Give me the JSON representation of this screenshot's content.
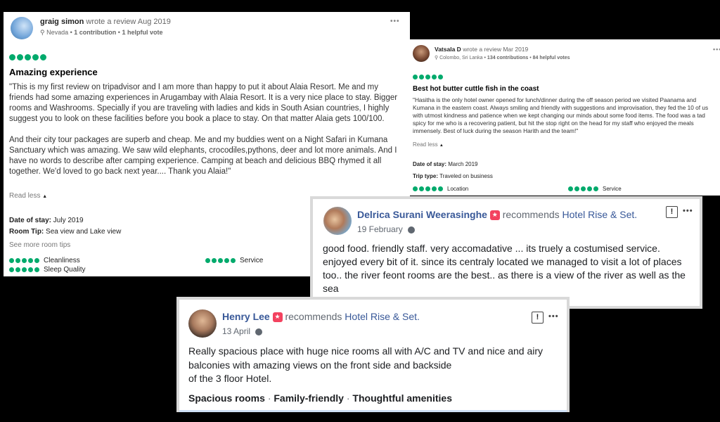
{
  "review1": {
    "reviewer": "graig simon",
    "action": "wrote a review Aug 2019",
    "location": "Nevada",
    "contributions": "1 contribution",
    "helpful": "1 helpful vote",
    "more": "•••",
    "rating": 5,
    "title": "Amazing experience",
    "body_p1": "\"This is my first review on tripadvisor and I am more than happy to put it about Alaia Resort. Me and my friends had some amazing experiences in Arugambay with Alaia Resort. It is a very nice place to stay. Bigger rooms and Washrooms. Specially if you are traveling with ladies and kids in South Asian countries, I highly suggest you to look on these facilities before you book a place to stay. On that matter Alaia gets 100/100.",
    "body_p2": "And their city tour packages are superb and cheap. Me and my buddies went on a Night Safari in Kumana Sanctuary which was amazing. We saw wild elephants, crocodiles,pythons, deer and lot more animals. And I have no words to describe after camping experience. Camping at beach and delicious BBQ rhymed it all together. We'd loved to go back next year.... Thank you Alaia!\"",
    "read_less": "Read less",
    "date_of_stay_label": "Date of stay:",
    "date_of_stay": "July 2019",
    "room_tip_label": "Room Tip:",
    "room_tip": "Sea view and Lake view",
    "see_more": "See more room tips",
    "subratings": [
      {
        "label": "Cleanliness",
        "rating": 5
      },
      {
        "label": "Service",
        "rating": 5
      },
      {
        "label": "Sleep Quality",
        "rating": 5
      }
    ]
  },
  "review2": {
    "reviewer": "Vatsala D",
    "action": "wrote a review Mar 2019",
    "location": "Colombo, Sri Lanka",
    "contributions": "134 contributions",
    "helpful": "84 helpful votes",
    "rating": 5,
    "title": "Best hot butter cuttle fish in the coast",
    "body": "\"Hasitha is the only hotel owner opened for lunch/dinner during the off season period we visited Paanama and Kumana in the eastern coast. Always smiling and friendly with suggestions and improvisation, they fed the 10 of us with utmost kindness and patience when we kept changing our minds about some food items. The food was a tad spicy for me who is a recovering patient, but hit the stop right on the head for my staff who enjoyed the meals immensely. Best of luck during the season Harith and the team!\"",
    "read_less": "Read less",
    "date_of_stay_label": "Date of stay:",
    "date_of_stay": "March 2019",
    "trip_type_label": "Trip type:",
    "trip_type": "Traveled on business",
    "subratings": [
      {
        "label": "Location",
        "rating": 5
      },
      {
        "label": "Service",
        "rating": 5
      }
    ]
  },
  "fb1": {
    "name": "Delrica Surani Weerasinghe",
    "recommends": "recommends",
    "hotel": "Hotel Rise & Set.",
    "date": "19 February",
    "body": "good food. friendly staff. very accomadative ... its truely a costumised service. enjoyed every bit of it. since its centraly located we managed to visit a lot of places too.. the river feont rooms are the best.. as there is a view of the river as well as the sea",
    "report": "!",
    "more": "•••"
  },
  "fb2": {
    "name": "Henry Lee",
    "recommends": "recommends",
    "hotel": "Hotel Rise & Set.",
    "date": "13 April",
    "body_line1": "Really spacious place with huge nice rooms all with A/C and TV and nice and airy",
    "body_line2": "balconies with amazing views on the front side and backside",
    "body_line3": "of the 3 floor Hotel.",
    "tags": [
      "Spacious rooms",
      "Family-friendly",
      "Thoughtful amenities"
    ],
    "tag_sep": "·",
    "report": "!",
    "more": "•••"
  },
  "colors": {
    "tripadvisor_green": "#00aa6c",
    "facebook_blue": "#385898",
    "recommend_badge": "#f3425f"
  }
}
